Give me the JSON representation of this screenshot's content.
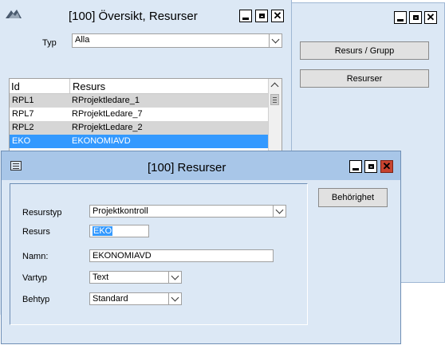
{
  "back_window": {
    "title": "[100]  Översikt, Resurser",
    "typ_label": "Typ",
    "typ_value": "Alla",
    "columns": [
      "Id",
      "Resurs"
    ],
    "rows": [
      {
        "id": "RPL1",
        "name": "RProjektledare_1"
      },
      {
        "id": "RPL7",
        "name": "RProjektLedare_7"
      },
      {
        "id": "RPL2",
        "name": "RProjektLedare_2"
      },
      {
        "id": "EKO",
        "name": "EKONOMIAVD"
      }
    ]
  },
  "right_window": {
    "buttons": [
      "Resurs / Grupp",
      "Resurser"
    ]
  },
  "front_window": {
    "title": "[100]  Resurser",
    "behorighet_button": "Behörighet",
    "fields": {
      "resurstyp": {
        "label": "Resurstyp",
        "value": "Projektkontroll"
      },
      "resurs": {
        "label": "Resurs",
        "value": "EKO"
      },
      "namn": {
        "label": "Namn:",
        "value": "EKONOMIAVD"
      },
      "vartyp": {
        "label": "Vartyp",
        "value": "Text"
      },
      "behtyp": {
        "label": "Behtyp",
        "value": "Standard"
      }
    }
  },
  "colors": {
    "window_bg": "#dce8f5",
    "titlebar": "#a8c6e8",
    "selection": "#3399ff",
    "close_red": "#c8432f"
  }
}
